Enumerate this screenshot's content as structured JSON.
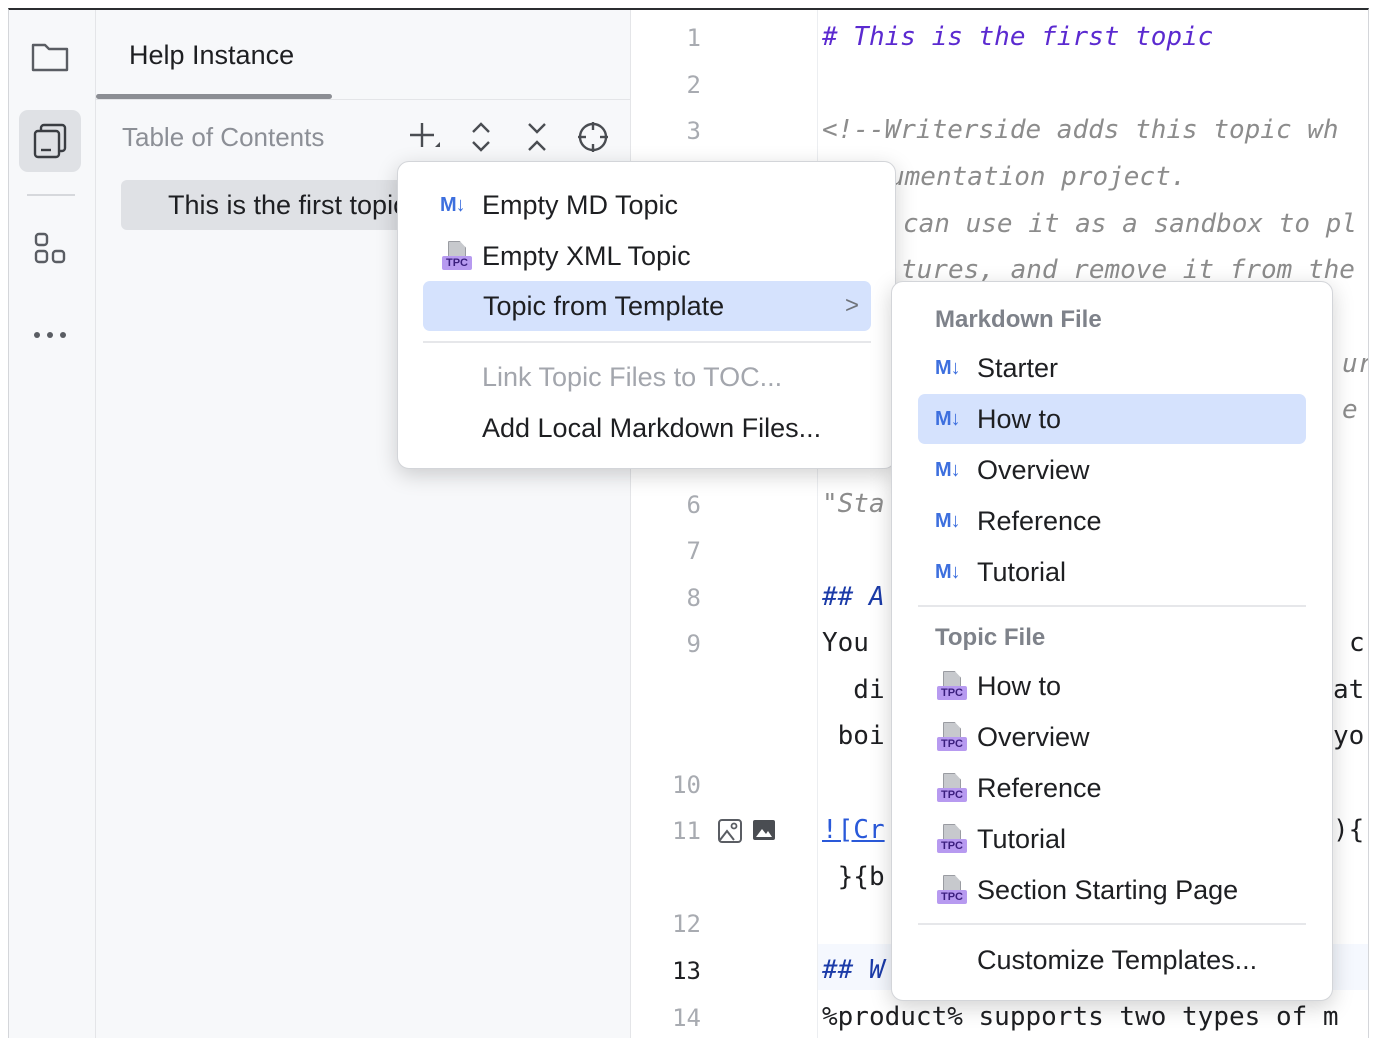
{
  "toolstrip": {
    "icons": [
      "folder-icon",
      "toc-icon",
      "structure-icon",
      "more-icon"
    ],
    "more_label": "..."
  },
  "panel": {
    "tab_title": "Help Instance",
    "toc_header": "Table of Contents",
    "toc_item": "This is the first topic",
    "tool_icons": [
      "add-icon",
      "expand-icon",
      "collapse-icon",
      "locate-icon"
    ]
  },
  "editor": {
    "lines": [
      {
        "num": "1",
        "text": "# This is the first topic"
      },
      {
        "num": "2",
        "text": ""
      },
      {
        "num": "3",
        "text": "<!--Writerside adds this topic wh"
      },
      {
        "num": "",
        "text": "umentation project."
      },
      {
        "num": "",
        "text": "can use it as a sandbox to pl"
      },
      {
        "num": "",
        "text": "tures, and remove it from the"
      },
      {
        "num": "",
        "text": "ur"
      },
      {
        "num": "",
        "text": "e"
      },
      {
        "num": "6",
        "text": "\"Sta"
      },
      {
        "num": "7",
        "text": ""
      },
      {
        "num": "8",
        "text": "## A"
      },
      {
        "num": "9",
        "text": "You "
      },
      {
        "num": "",
        "text": "  di"
      },
      {
        "num": "",
        "text": " boi"
      },
      {
        "num": "10",
        "text": ""
      },
      {
        "num": "11",
        "text": "![Cr"
      },
      {
        "num": "",
        "text": " }{b"
      },
      {
        "num": "12",
        "text": ""
      },
      {
        "num": "13",
        "text": "## W"
      },
      {
        "num": "14",
        "text": "%product% supports two types of m"
      }
    ],
    "right_fragments": [
      "c",
      "at",
      "yo",
      "){"
    ]
  },
  "menu1": {
    "items": [
      {
        "label": "Empty MD Topic",
        "icon": "md-icon",
        "icon_text": "M↓"
      },
      {
        "label": "Empty XML Topic",
        "icon": "tpc-icon",
        "icon_text": "TPC"
      },
      {
        "label": "Topic from Template",
        "chevron": ">"
      },
      {
        "label": "Link Topic Files to TOC...",
        "disabled": true
      },
      {
        "label": "Add Local Markdown Files..."
      }
    ]
  },
  "menu2": {
    "section_markdown": "Markdown File",
    "markdown_items": [
      "Starter",
      "How to",
      "Overview",
      "Reference",
      "Tutorial"
    ],
    "section_topic": "Topic File",
    "topic_items": [
      "How to",
      "Overview",
      "Reference",
      "Tutorial",
      "Section Starting Page"
    ],
    "customize": "Customize Templates...",
    "md_icon_text": "M↓",
    "tpc_icon_text": "TPC",
    "selected": "How to"
  }
}
